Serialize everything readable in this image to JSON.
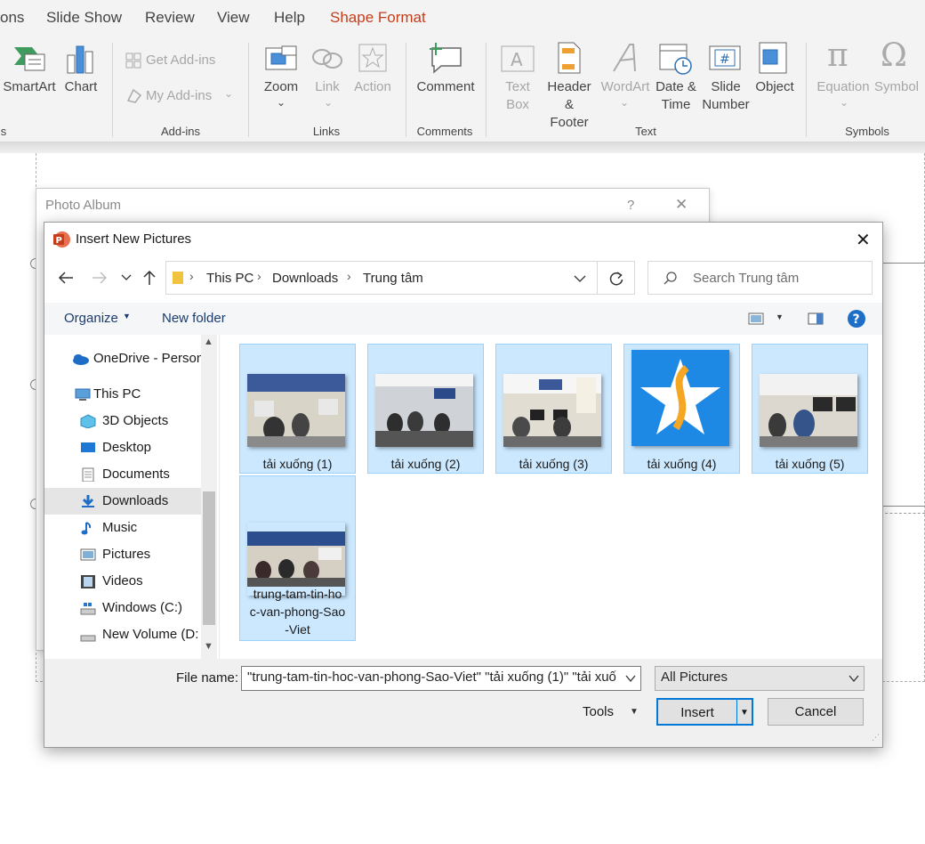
{
  "ribbon_tabs": [
    "ons",
    "Slide Show",
    "Review",
    "View",
    "Help",
    "Shape Format"
  ],
  "ribbon": {
    "smartart": "SmartArt",
    "chart": "Chart",
    "get_addins": "Get Add-ins",
    "my_addins": "My Add-ins",
    "addins_group": "Add-ins",
    "zoom": "Zoom",
    "link": "Link",
    "action": "Action",
    "links_group": "Links",
    "comment": "Comment",
    "comments_group": "Comments",
    "text_box": "Text\nBox",
    "header_footer": "Header\n& Footer",
    "wordart": "WordArt",
    "date_time": "Date &\nTime",
    "slide_number": "Slide\nNumber",
    "object": "Object",
    "text_group": "Text",
    "equation": "Equation",
    "symbol": "Symbol",
    "symbols_group": "Symbols",
    "left_group_tail": "s"
  },
  "album": {
    "title": "Photo Album",
    "help": "?",
    "close": "✕"
  },
  "dialog": {
    "title": "Insert New Pictures",
    "close": "✕",
    "breadcrumb": [
      "This PC",
      "Downloads",
      "Trung tâm"
    ],
    "search_placeholder": "Search Trung tâm",
    "organize": "Organize",
    "new_folder": "New folder",
    "nav": [
      {
        "label": "OneDrive - Person",
        "icon": "cloud"
      },
      {
        "label": "This PC",
        "icon": "pc"
      },
      {
        "label": "3D Objects",
        "icon": "cube"
      },
      {
        "label": "Desktop",
        "icon": "desktop"
      },
      {
        "label": "Documents",
        "icon": "document"
      },
      {
        "label": "Downloads",
        "icon": "download"
      },
      {
        "label": "Music",
        "icon": "music"
      },
      {
        "label": "Pictures",
        "icon": "picture"
      },
      {
        "label": "Videos",
        "icon": "video"
      },
      {
        "label": "Windows (C:)",
        "icon": "drive"
      },
      {
        "label": "New Volume (D:",
        "icon": "drive"
      }
    ],
    "files": [
      {
        "name": "tải xuống (1)"
      },
      {
        "name": "tải xuống (2)"
      },
      {
        "name": "tải xuống (3)"
      },
      {
        "name": "tải xuống (4)"
      },
      {
        "name": "tải xuống (5)"
      },
      {
        "name": "trung-tam-tin-ho\nc-van-phong-Sao\n-Viet"
      }
    ],
    "file_name_label": "File name:",
    "file_name_value": "\"trung-tam-tin-hoc-van-phong-Sao-Viet\" \"tải xuống (1)\" \"tải xuố",
    "file_type": "All Pictures",
    "tools": "Tools",
    "insert": "Insert",
    "cancel": "Cancel"
  },
  "colors": {
    "accent": "#c43e1c",
    "selection": "#cce8ff",
    "help_blue": "#1e6ec8"
  }
}
